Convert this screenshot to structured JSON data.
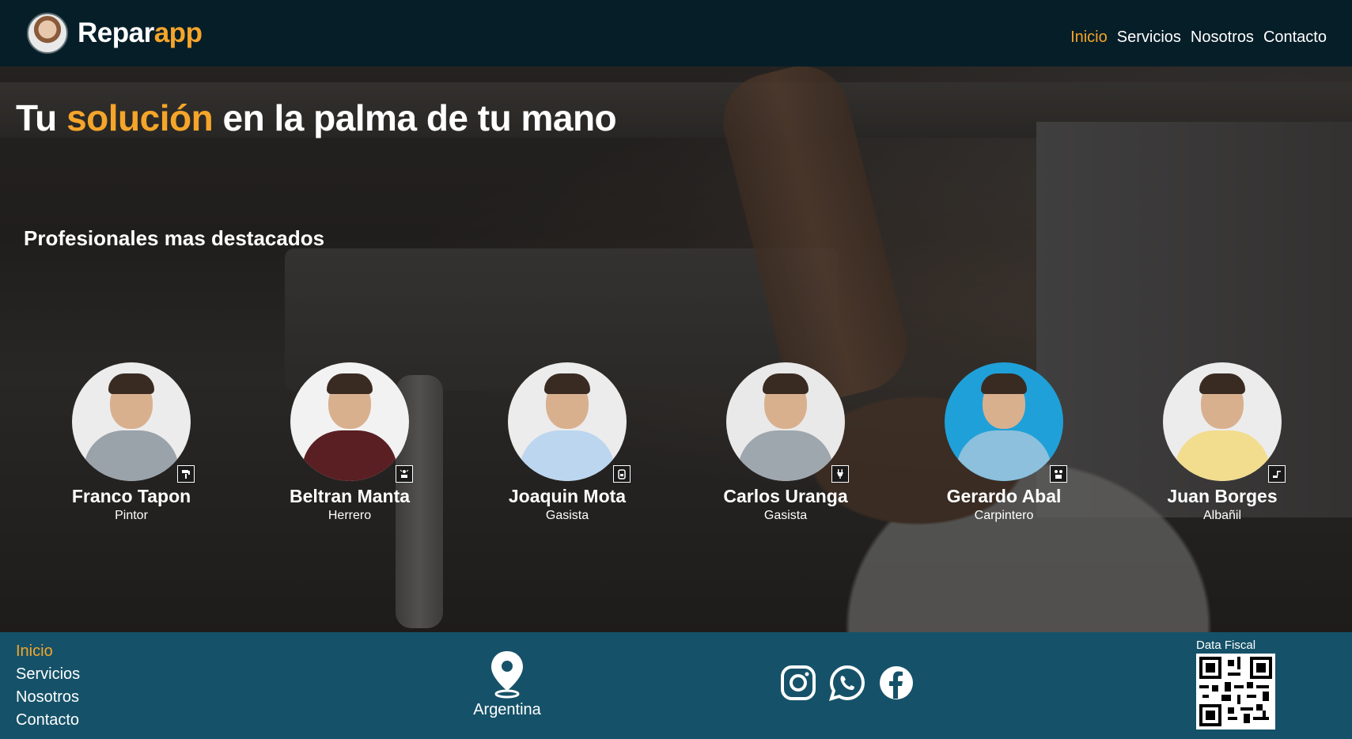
{
  "header": {
    "brand": {
      "part1": "Repar",
      "part2": "app"
    },
    "nav": [
      {
        "label": "Inicio",
        "active": true
      },
      {
        "label": "Servicios",
        "active": false
      },
      {
        "label": "Nosotros",
        "active": false
      },
      {
        "label": "Contacto",
        "active": false
      }
    ]
  },
  "hero": {
    "title": {
      "part1": "Tu ",
      "accent": "solución",
      "part2": " en la palma de tu mano"
    },
    "section_title": "Profesionales mas destacados",
    "professionals": [
      {
        "name": "Franco Tapon",
        "role": "Pintor",
        "icon": "paint-roller-icon",
        "shirt": "#9aa2aa",
        "bg": "#ececec"
      },
      {
        "name": "Beltran Manta",
        "role": "Herrero",
        "icon": "welding-icon",
        "shirt": "#5a1f22",
        "bg": "#f2f2f2"
      },
      {
        "name": "Joaquin Mota",
        "role": "Gasista",
        "icon": "gas-cylinder-icon",
        "shirt": "#bcd6ef",
        "bg": "#ececec"
      },
      {
        "name": "Carlos Uranga",
        "role": "Gasista",
        "icon": "plug-icon",
        "shirt": "#9fa7ae",
        "bg": "#e9e9e9"
      },
      {
        "name": "Gerardo Abal",
        "role": "Carpintero",
        "icon": "tools-icon",
        "shirt": "#8cc0dc",
        "bg": "#1fa0d8"
      },
      {
        "name": "Juan Borges",
        "role": "Albañil",
        "icon": "trowel-icon",
        "shirt": "#f2dc8e",
        "bg": "#ececec"
      }
    ]
  },
  "footer": {
    "nav": [
      {
        "label": "Inicio",
        "active": true
      },
      {
        "label": "Servicios",
        "active": false
      },
      {
        "label": "Nosotros",
        "active": false
      },
      {
        "label": "Contacto",
        "active": false
      }
    ],
    "location": "Argentina",
    "socials": [
      "instagram-icon",
      "whatsapp-icon",
      "facebook-icon"
    ],
    "fiscal_label": "Data Fiscal"
  },
  "colors": {
    "accent": "#f5a52a",
    "header_bg": "#061e28",
    "footer_bg": "#155269"
  }
}
